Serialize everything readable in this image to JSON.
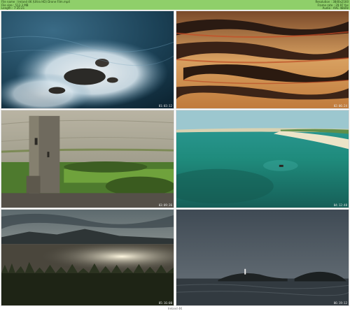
{
  "header": {
    "left_lines": [
      "File name : Ireland 4K (Ultra HD) Drone Film.mp4",
      "File size : 512.3 MB",
      "Length : 7:35:21"
    ],
    "right_lines": [
      "Resolution : 3840x2160",
      "Frame rate : 29.97 fps",
      "Audio : AAC 48kHz"
    ],
    "background": "#8fcf6a"
  },
  "thumbnails": [
    {
      "scene": "aerial ocean waves over rocks",
      "timestamp": "01:03:12"
    },
    {
      "scene": "sunset layered clouds",
      "timestamp": "02:06:24"
    },
    {
      "scene": "stone tower ruin in limestone hills",
      "timestamp": "03:09:36"
    },
    {
      "scene": "turquoise bay with boat and beach",
      "timestamp": "04:12:48"
    },
    {
      "scene": "sunlit lake with mountains and grass",
      "timestamp": "05:16:00"
    },
    {
      "scene": "lighthouse island on grey sea",
      "timestamp": "06:19:12"
    }
  ],
  "footer": {
    "text": "Ireland 4K"
  }
}
